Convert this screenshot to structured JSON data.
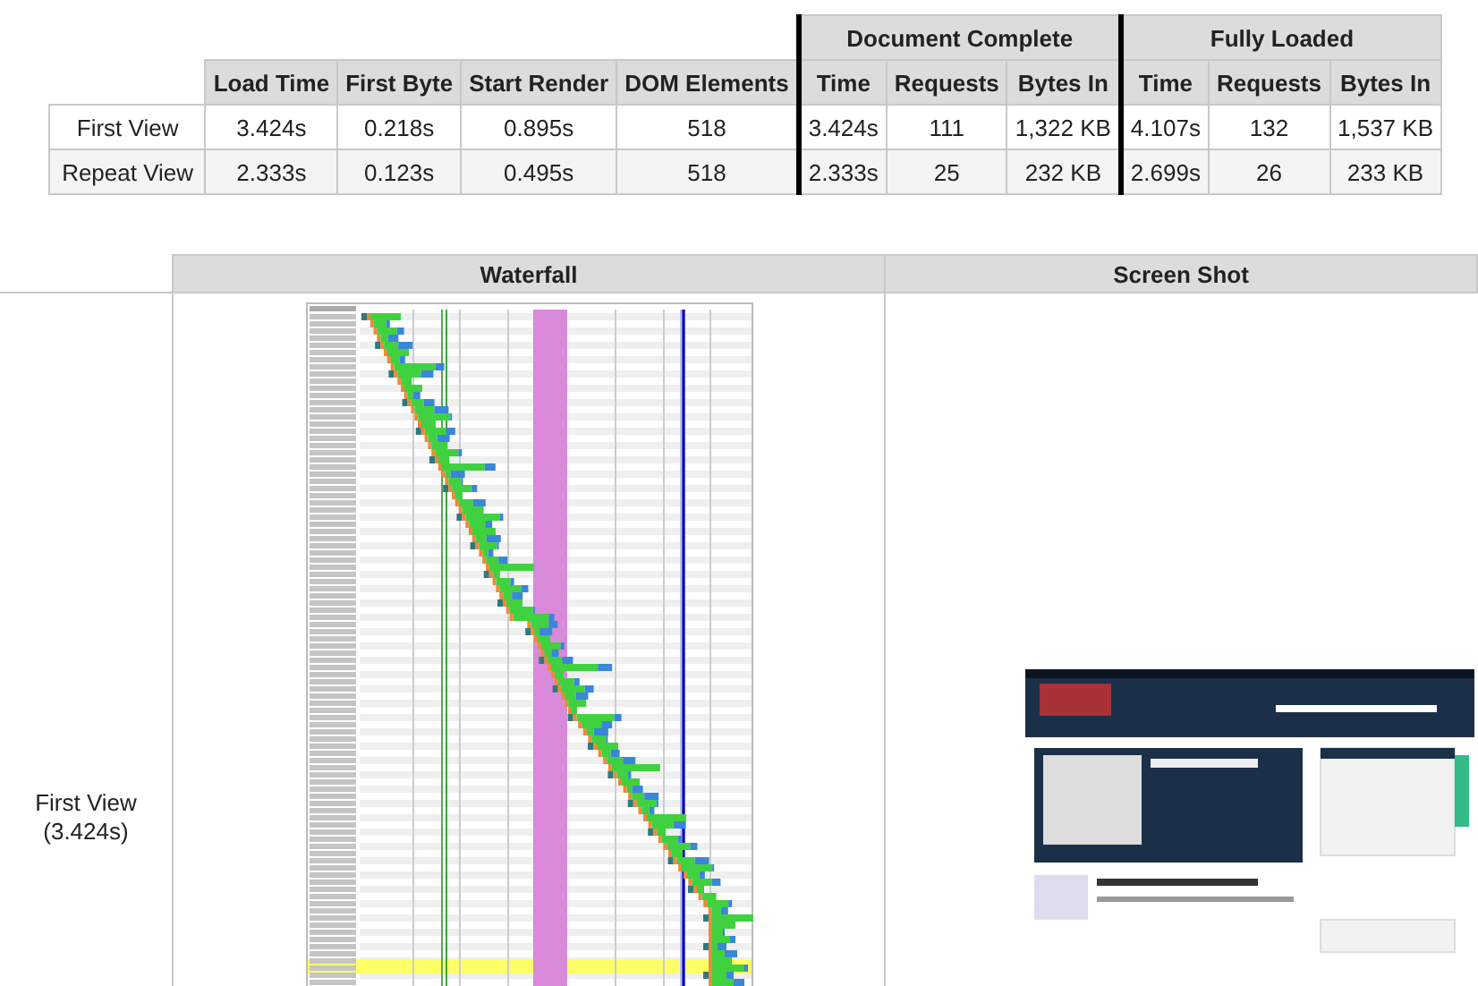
{
  "summary_table": {
    "columns": [
      "Load Time",
      "First Byte",
      "Start Render",
      "DOM Elements"
    ],
    "groups": [
      {
        "label": "Document Complete",
        "columns": [
          "Time",
          "Requests",
          "Bytes In"
        ]
      },
      {
        "label": "Fully Loaded",
        "columns": [
          "Time",
          "Requests",
          "Bytes In"
        ]
      }
    ],
    "rows": [
      {
        "label": "First View",
        "cells": [
          "3.424s",
          "0.218s",
          "0.895s",
          "518",
          "3.424s",
          "111",
          "1,322 KB",
          "4.107s",
          "132",
          "1,537 KB"
        ]
      },
      {
        "label": "Repeat View",
        "cells": [
          "2.333s",
          "0.123s",
          "0.495s",
          "518",
          "2.333s",
          "25",
          "232 KB",
          "2.699s",
          "26",
          "233 KB"
        ]
      }
    ]
  },
  "details_table": {
    "columns": [
      "Waterfall",
      "Screen Shot"
    ],
    "rows": [
      {
        "label": "First View",
        "sublabel": "(3.424s)"
      }
    ]
  }
}
